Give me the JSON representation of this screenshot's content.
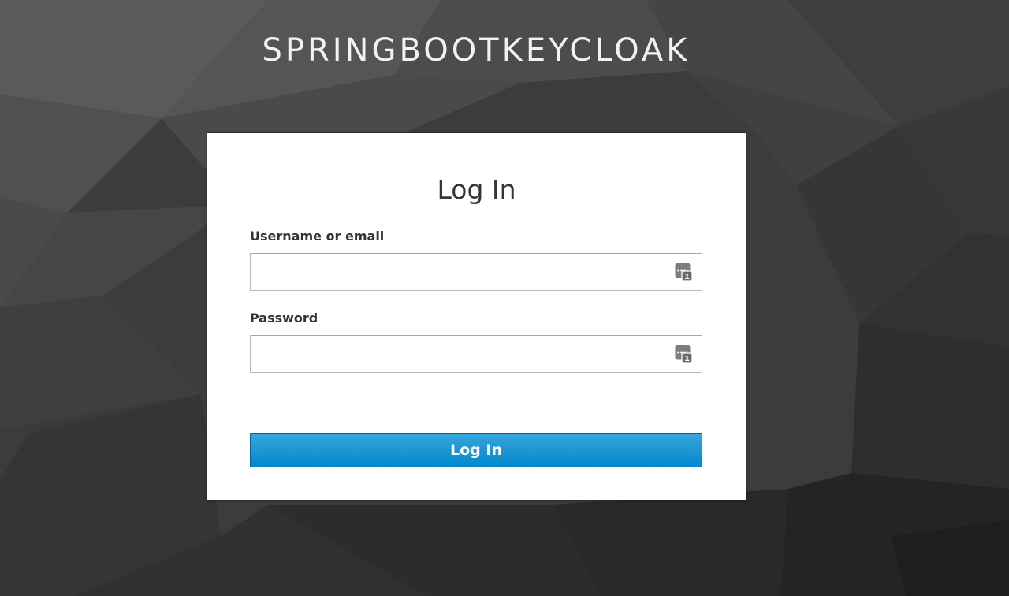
{
  "realm": {
    "title": "SPRINGBOOTKEYCLOAK"
  },
  "login_form": {
    "heading": "Log In",
    "username": {
      "label": "Username or email",
      "value": "",
      "placeholder": ""
    },
    "password": {
      "label": "Password",
      "value": "",
      "placeholder": ""
    },
    "submit_label": "Log In",
    "field_icon": "password-manager-autofill-icon"
  },
  "colors": {
    "button_top": "#39a5dc",
    "button_bottom": "#0088ce",
    "background": "#3a3a3a",
    "card": "#ffffff"
  }
}
